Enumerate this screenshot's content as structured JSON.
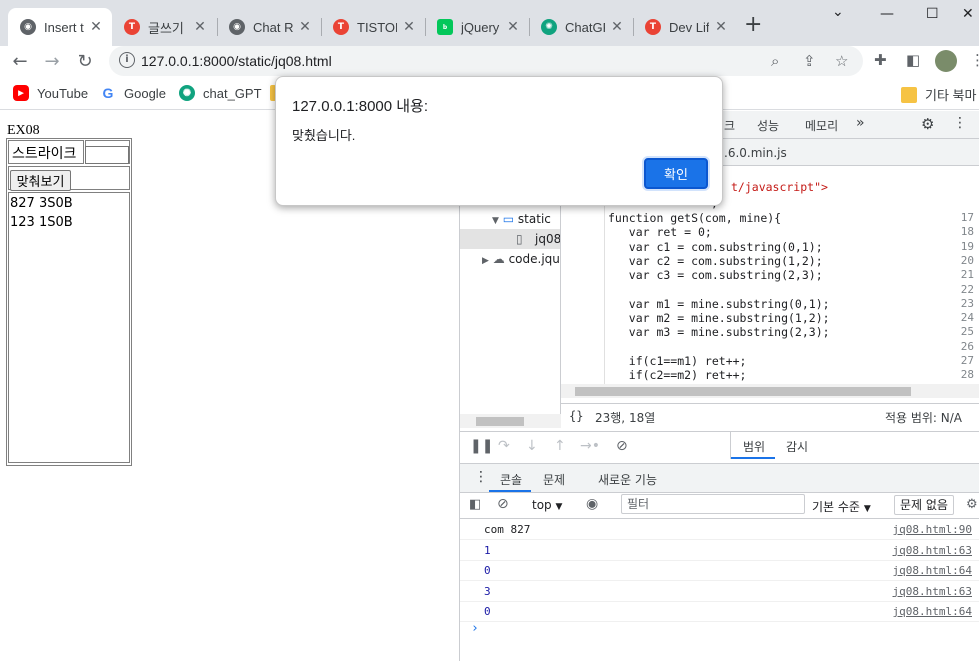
{
  "browser": {
    "tabs": [
      {
        "title": "Insert t",
        "icon": "globe-icon",
        "color": "#5f6368",
        "active": true
      },
      {
        "title": "글쓰기",
        "icon": "tistory-icon",
        "color": "#ea4335",
        "active": false
      },
      {
        "title": "Chat R",
        "icon": "globe-icon",
        "color": "#5f6368",
        "active": false
      },
      {
        "title": "TISTOR",
        "icon": "tistory-icon",
        "color": "#ea4335",
        "active": false
      },
      {
        "title": "jQuery",
        "icon": "blog-icon",
        "color": "#03c75a",
        "active": false
      },
      {
        "title": "ChatGP",
        "icon": "chatgpt-icon",
        "color": "#10a37f",
        "active": false
      },
      {
        "title": "Dev Lif",
        "icon": "tistory-icon",
        "color": "#ea4335",
        "active": false
      }
    ],
    "new_tab_glyph": "+",
    "url": "127.0.0.1:8000/static/jq08.html",
    "bookmarks": [
      {
        "label": "YouTube",
        "icon": "youtube-icon",
        "color": "#ff0000"
      },
      {
        "label": "Google",
        "icon": "google-icon",
        "color": "#4285f4"
      },
      {
        "label": "chat_GPT",
        "icon": "chatgpt-icon",
        "color": "#10a37f"
      }
    ],
    "other_bookmarks": "기타 북마"
  },
  "page": {
    "heading": "EX08",
    "strike_label": "스트라이크",
    "guess_button": "맞춰보기",
    "results": [
      "827 3S0B",
      "123 1S0B"
    ]
  },
  "alert": {
    "title": "127.0.0.1:8000 내용:",
    "message": "맞췄습니다.",
    "ok_label": "확인"
  },
  "devtools": {
    "panel_tabs": [
      "크",
      "성능",
      "메모리",
      "»"
    ],
    "open_file": ".6.0.min.js",
    "tree": {
      "folder": "static",
      "file": "jq08",
      "cloud": "code.jque"
    },
    "code_header": "t/javascript\">",
    "code_header2": ";",
    "code_lines": [
      {
        "n": "17",
        "text": "function getS(com, mine){"
      },
      {
        "n": "18",
        "text": "   var ret = 0;"
      },
      {
        "n": "19",
        "text": "   var c1 = com.substring(0,1);"
      },
      {
        "n": "20",
        "text": "   var c2 = com.substring(1,2);"
      },
      {
        "n": "21",
        "text": "   var c3 = com.substring(2,3);"
      },
      {
        "n": "22",
        "text": ""
      },
      {
        "n": "23",
        "text": "   var m1 = mine.substring(0,1);"
      },
      {
        "n": "24",
        "text": "   var m2 = mine.substring(1,2);"
      },
      {
        "n": "25",
        "text": "   var m3 = mine.substring(2,3);"
      },
      {
        "n": "26",
        "text": ""
      },
      {
        "n": "27",
        "text": "   if(c1==m1) ret++;"
      },
      {
        "n": "28",
        "text": "   if(c2==m2) ret++;"
      }
    ],
    "status_position": "23행, 18열",
    "status_coverage": "적용 범위: N/A",
    "scope_tabs": [
      "범위",
      "감시"
    ],
    "drawer_tabs": [
      "콘솔",
      "문제",
      "새로운 기능"
    ],
    "console_context": "top",
    "filter_placeholder": "필터",
    "log_level": "기본 수준",
    "issues_badge": "문제 없음",
    "console_rows": [
      {
        "msg": "com 827",
        "src": "jq08.html:90"
      },
      {
        "msg": "1",
        "src": "jq08.html:63"
      },
      {
        "msg": "0",
        "src": "jq08.html:64"
      },
      {
        "msg": "3",
        "src": "jq08.html:63"
      },
      {
        "msg": "0",
        "src": "jq08.html:64"
      }
    ],
    "prompt": "›"
  }
}
